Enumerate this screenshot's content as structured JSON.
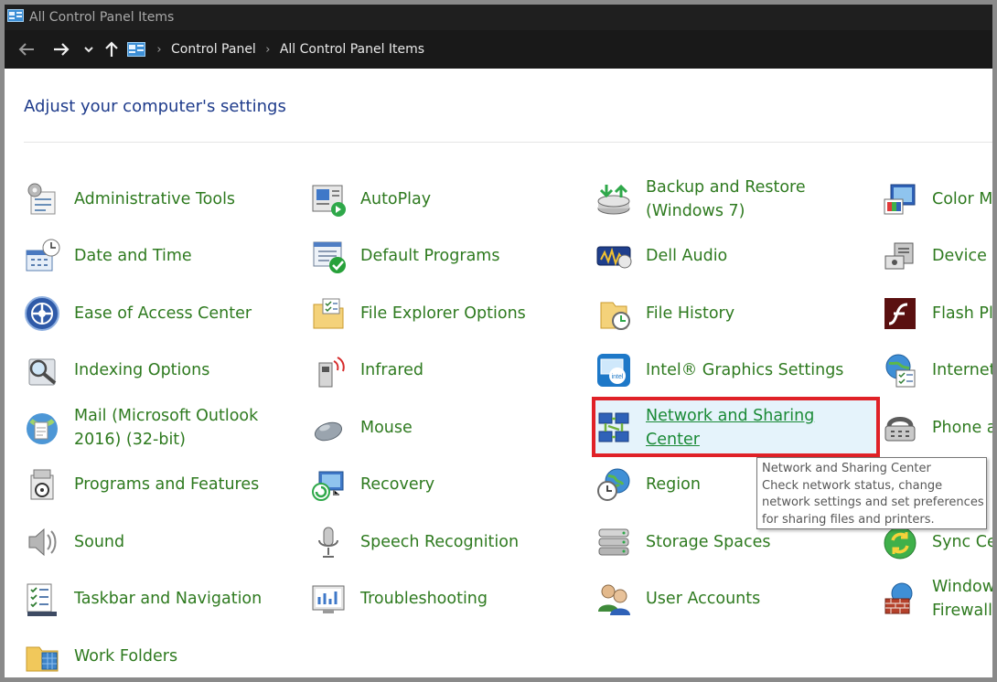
{
  "window": {
    "title": "All Control Panel Items"
  },
  "breadcrumb": [
    "Control Panel",
    "All Control Panel Items"
  ],
  "heading": "Adjust your computer's settings",
  "columns": [
    [
      "Administrative Tools",
      "Date and Time",
      "Ease of Access Center",
      "Indexing Options",
      "Mail (Microsoft Outlook|2016) (32-bit)",
      "Programs and Features",
      "Sound",
      "Taskbar and Navigation",
      "Work Folders"
    ],
    [
      "AutoPlay",
      "Default Programs",
      "File Explorer Options",
      "Infrared",
      "Mouse",
      "Recovery",
      "Speech Recognition",
      "Troubleshooting"
    ],
    [
      "Backup and Restore|(Windows 7)",
      "Dell Audio",
      "File History",
      "Intel® Graphics Settings",
      "Network and Sharing|Center",
      "Region",
      "Storage Spaces",
      "User Accounts"
    ],
    [
      "Color M",
      "Device",
      "Flash Pl",
      "Internet",
      "Phone a",
      "",
      "Sync Ce",
      "Window|Firewall"
    ]
  ],
  "icons": [
    [
      "admin-tools-icon",
      "date-time-icon",
      "ease-of-access-icon",
      "indexing-icon",
      "mail-icon",
      "programs-features-icon",
      "sound-icon",
      "taskbar-icon",
      "work-folders-icon"
    ],
    [
      "autoplay-icon",
      "default-programs-icon",
      "folder-options-icon",
      "infrared-icon",
      "mouse-icon",
      "recovery-icon",
      "microphone-icon",
      "troubleshooting-icon"
    ],
    [
      "backup-restore-icon",
      "dell-audio-icon",
      "file-history-icon",
      "intel-graphics-icon",
      "network-icon",
      "region-icon",
      "storage-spaces-icon",
      "user-accounts-icon"
    ],
    [
      "color-management-icon",
      "device-manager-icon",
      "flash-player-icon",
      "internet-options-icon",
      "phone-modem-icon",
      "",
      "sync-center-icon",
      "firewall-icon"
    ]
  ],
  "selected": {
    "column": 2,
    "row": 4
  },
  "tooltip": {
    "title": "Network and Sharing Center",
    "lines": [
      "Check network status, change",
      "network settings and set preferences",
      "for sharing files and printers."
    ]
  },
  "colors": {
    "link": "#2e7a1f",
    "heading": "#1e3b8b",
    "highlight": "#e02127"
  }
}
